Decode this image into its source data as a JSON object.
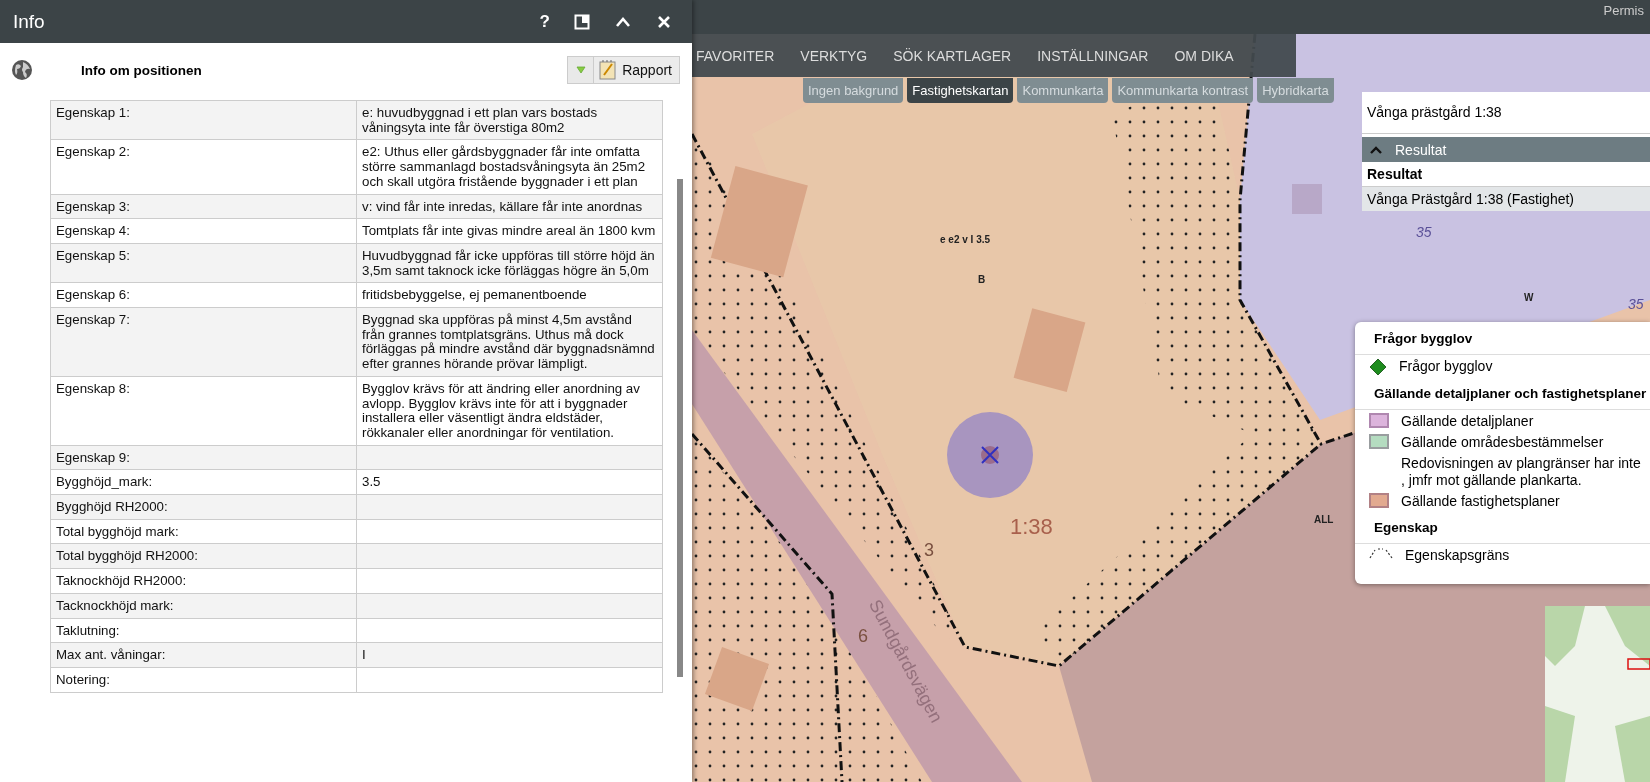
{
  "info_panel": {
    "title": "Info",
    "header_buttons": [
      {
        "kind": "help",
        "label": "?"
      },
      {
        "kind": "dock"
      },
      {
        "kind": "collapse"
      },
      {
        "kind": "close"
      }
    ],
    "subtitle": "Info om positionen",
    "report_button": "Rapport",
    "properties": [
      {
        "name": "Egenskap 1:",
        "value": "e: huvudbyggnad i ett plan vars bostads våningsyta inte får överstiga 80m2"
      },
      {
        "name": "Egenskap 2:",
        "value": "e2: Uthus eller gårdsbyggnader får inte omfatta större sammanlagd bostadsvåningsyta än 25m2 och skall utgöra fristående byggnader i ett plan"
      },
      {
        "name": "Egenskap 3:",
        "value": "v: vind får inte inredas, källare får inte anordnas"
      },
      {
        "name": "Egenskap 4:",
        "value": "Tomtplats får inte givas mindre areal än 1800 kvm"
      },
      {
        "name": "Egenskap 5:",
        "value": "Huvudbyggnad får icke uppföras till större höjd än 3,5m samt taknock icke förläggas högre än 5,0m"
      },
      {
        "name": "Egenskap 6:",
        "value": "fritidsbebyggelse, ej pemanentboende"
      },
      {
        "name": "Egenskap 7:",
        "value": "Byggnad ska uppföras på minst 4,5m avstånd från grannes tomtplatsgräns. Uthus må dock förläggas på mindre avstånd där byggnadsnämnd efter grannes hörande prövar lämpligt."
      },
      {
        "name": "Egenskap 8:",
        "value": "Bygglov krävs för att ändring eller anordning av avlopp. Bygglov krävs inte för att i byggnader installera eller väsentligt ändra eldstäder, rökkanaler eller anordningar för ventilation."
      },
      {
        "name": "Egenskap 9:"
      },
      {
        "name": "Bygghöjd_mark:",
        "value": "3.5"
      },
      {
        "name": "Bygghöjd RH2000:"
      },
      {
        "name": "Total bygghöjd mark:"
      },
      {
        "name": "Total bygghöjd RH2000:"
      },
      {
        "name": "Taknockhöjd RH2000:"
      },
      {
        "name": "Tacknockhöjd mark:"
      },
      {
        "name": "Taklutning:"
      },
      {
        "name": "Max ant. våningar:",
        "value": "I"
      },
      {
        "name": "Notering:"
      }
    ]
  },
  "top_bar": {
    "user_label": "Permis"
  },
  "menu": [
    "FAVORITER",
    "VERKTYG",
    "SÖK KARTLAGER",
    "INSTÄLLNINGAR",
    "OM DIKA"
  ],
  "background_tabs": [
    {
      "label": "Ingen bakgrund",
      "selected": false
    },
    {
      "label": "Fastighetskartan",
      "selected": true
    },
    {
      "label": "Kommunkarta",
      "selected": false
    },
    {
      "label": "Kommunkarta kontrast",
      "selected": false
    },
    {
      "label": "Hybridkarta",
      "selected": false
    }
  ],
  "search_panel": {
    "query": "Vånga prästgård 1:38",
    "section_title": "Resultat",
    "expanded": true,
    "results_heading": "Resultat",
    "results": [
      {
        "label": "Vånga Prästgård 1:38 (Fastighet)",
        "selected": true
      }
    ]
  },
  "legend": {
    "sections": [
      {
        "title": "Frågor bygglov",
        "items": [
          {
            "kind": "diamond",
            "label": "Frågor bygglov",
            "color": "#1e8c1e"
          }
        ]
      },
      {
        "title": "Gällande detaljplaner och fastighetsplaner",
        "items": [
          {
            "kind": "swatch",
            "label": "Gällande detaljplaner",
            "color": "#dcb4dc"
          },
          {
            "kind": "swatch",
            "label": "Gällande områdesbestämmelser",
            "color": "#b4dcc0"
          },
          {
            "kind": "note",
            "label": "Redovisningen av plangränser har inte\n, jmfr mot gällande plankarta."
          },
          {
            "kind": "swatch",
            "label": "Gällande fastighetsplaner",
            "color": "#e2aa90"
          }
        ]
      },
      {
        "title": "Egenskap",
        "items": [
          {
            "kind": "line",
            "label": "Egenskapsgräns"
          }
        ]
      }
    ]
  },
  "map_labels": [
    "e e2 v I 3.5",
    "B",
    "1:38",
    "3",
    "6",
    "Sundgårdsvägen",
    "W",
    "35",
    "35",
    "ALL"
  ]
}
